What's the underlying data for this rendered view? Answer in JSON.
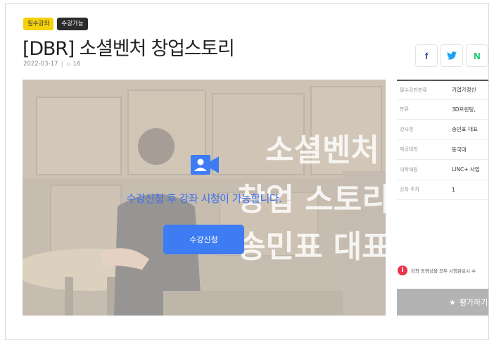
{
  "badges": {
    "required": "필수강좌",
    "available": "수강가능"
  },
  "course": {
    "title": "[DBR] 소셜벤처 창업스토리",
    "date": "2022-03-17",
    "views": "16"
  },
  "share": {
    "facebook": "f",
    "twitter": "t",
    "naver": "N"
  },
  "video": {
    "message": "수강신청 후 강좌 시청이 가능합니다.",
    "enroll_button": "수강신청",
    "bg_text": [
      "소셜벤처",
      "창업 스토리",
      "송민표 대표"
    ]
  },
  "info": {
    "rows": [
      {
        "label": "필수강좌분류",
        "value": "기업가정신"
      },
      {
        "label": "분류",
        "value": "3D프린팅,"
      },
      {
        "label": "강사명",
        "value": "송민표 대표"
      },
      {
        "label": "제공대학",
        "value": "동국대"
      },
      {
        "label": "대학재원",
        "value": "LINC+ 사업"
      },
      {
        "label": "강좌 주차",
        "value": "1"
      }
    ]
  },
  "notice": {
    "icon": "i",
    "text": "강좌 동영상을 모두 시청완료시 수"
  },
  "rate": {
    "label": "평가하기"
  },
  "colors": {
    "accent": "#3d7cf3",
    "badge_yellow": "#f5d10a",
    "notice_red": "#e8344d"
  }
}
